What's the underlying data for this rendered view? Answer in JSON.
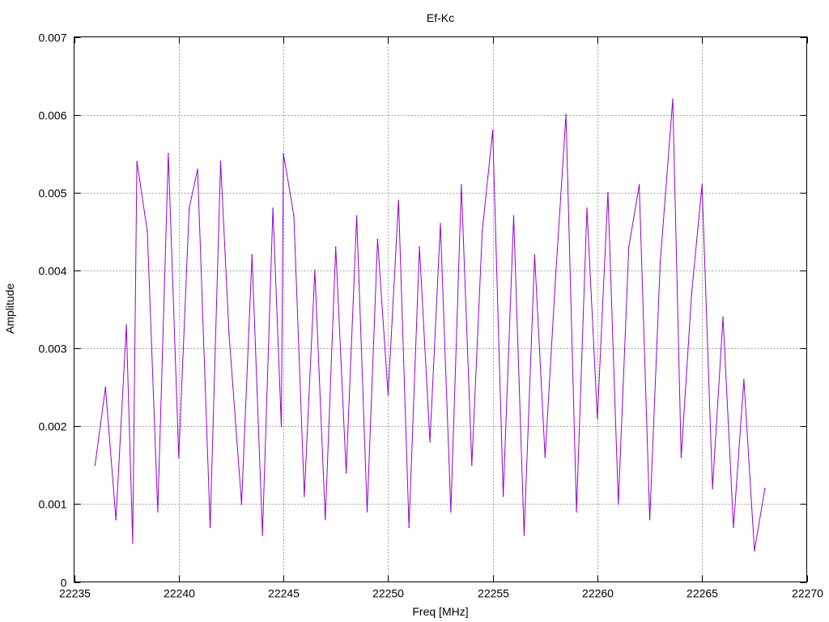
{
  "chart_data": {
    "type": "line",
    "title": "Ef-Kc",
    "xlabel": "Freq [MHz]",
    "ylabel": "Amplitude",
    "xlim": [
      22235,
      22270
    ],
    "ylim": [
      0,
      0.007
    ],
    "xticks": [
      22235,
      22240,
      22245,
      22250,
      22255,
      22260,
      22265,
      22270
    ],
    "xtick_labels": [
      "22235",
      "22240",
      "22245",
      "22250",
      "22255",
      "22260",
      "22265",
      "22270"
    ],
    "yticks": [
      0,
      0.001,
      0.002,
      0.003,
      0.004,
      0.005,
      0.006,
      0.007
    ],
    "ytick_labels": [
      "0",
      "0.001",
      "0.002",
      "0.003",
      "0.004",
      "0.005",
      "0.006",
      "0.007"
    ],
    "grid": true,
    "legend": "none",
    "series": [
      {
        "color": "#9400d3",
        "x": [
          22236.0,
          22236.5,
          22237.0,
          22237.5,
          22237.8,
          22238.0,
          22238.5,
          22239.0,
          22239.5,
          22240.0,
          22240.5,
          22240.9,
          22241.5,
          22242.0,
          22242.4,
          22243.0,
          22243.5,
          22244.0,
          22244.5,
          22244.9,
          22245.0,
          22245.5,
          22246.0,
          22246.5,
          22247.0,
          22247.5,
          22248.0,
          22248.5,
          22249.0,
          22249.5,
          22250.0,
          22250.5,
          22251.0,
          22251.5,
          22252.0,
          22252.5,
          22253.0,
          22253.5,
          22254.0,
          22254.5,
          22255.0,
          22255.5,
          22256.0,
          22256.5,
          22257.0,
          22257.5,
          22258.0,
          22258.5,
          22259.0,
          22259.5,
          22260.0,
          22260.5,
          22261.0,
          22261.5,
          22262.0,
          22262.5,
          22263.0,
          22263.6,
          22264.0,
          22264.5,
          22265.0,
          22265.5,
          22266.0,
          22266.5,
          22267.0,
          22267.5,
          22268.0
        ],
        "y": [
          0.0015,
          0.0025,
          0.0008,
          0.0033,
          0.0005,
          0.0054,
          0.0045,
          0.0009,
          0.0055,
          0.0016,
          0.0048,
          0.0053,
          0.0007,
          0.0054,
          0.0032,
          0.001,
          0.0042,
          0.0006,
          0.0048,
          0.002,
          0.0055,
          0.0047,
          0.0011,
          0.004,
          0.0008,
          0.0043,
          0.0014,
          0.0047,
          0.0009,
          0.0044,
          0.0024,
          0.0049,
          0.0007,
          0.0043,
          0.0018,
          0.0046,
          0.0009,
          0.0051,
          0.0015,
          0.0045,
          0.0058,
          0.0011,
          0.0047,
          0.0006,
          0.0042,
          0.0016,
          0.0039,
          0.006,
          0.0009,
          0.0048,
          0.0021,
          0.005,
          0.001,
          0.0043,
          0.0051,
          0.0008,
          0.0041,
          0.0062,
          0.0016,
          0.0037,
          0.0051,
          0.0012,
          0.0034,
          0.0007,
          0.0026,
          0.0004,
          0.0012
        ]
      }
    ]
  }
}
